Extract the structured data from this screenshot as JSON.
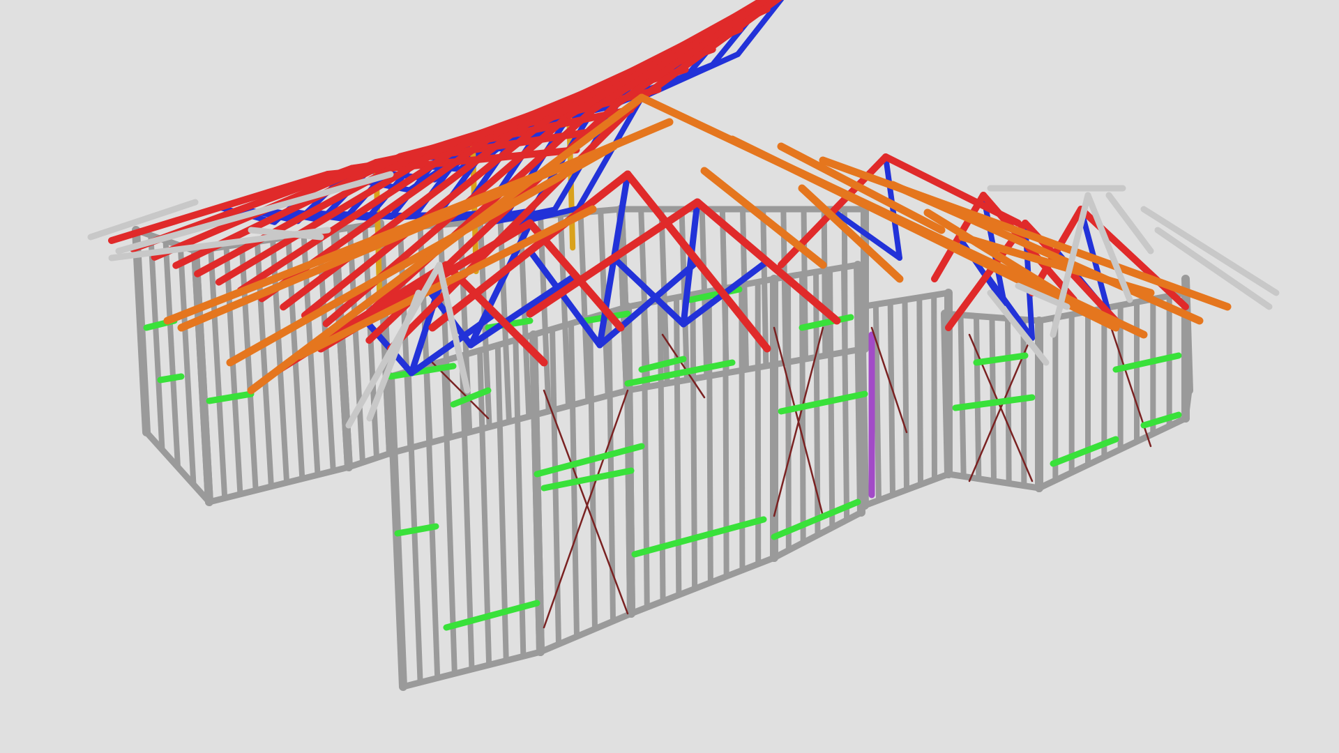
{
  "scene": {
    "description_label": "",
    "background_color": "#e0e0e0",
    "member_colors": {
      "wall_frame": "#9a9a9a",
      "nogging": "#39e13a",
      "top_chord": "#e02a2a",
      "hip_rafter": "#e5761e",
      "web": "#2232d8",
      "brace": "#7a2222",
      "girder_post": "#d9a21c",
      "lintel_block": "#a24bc7",
      "gable_member": "#c8c8c8"
    }
  }
}
